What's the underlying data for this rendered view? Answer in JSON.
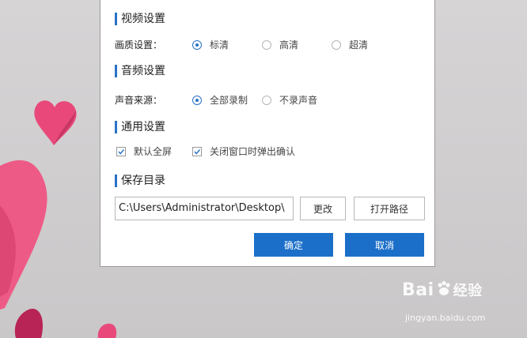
{
  "video": {
    "title": "视频设置",
    "quality_label": "画质设置：",
    "options": [
      {
        "label": "标清",
        "selected": true
      },
      {
        "label": "高清",
        "selected": false
      },
      {
        "label": "超清",
        "selected": false
      }
    ]
  },
  "audio": {
    "title": "音频设置",
    "source_label": "声音来源：",
    "options": [
      {
        "label": "全部录制",
        "selected": true
      },
      {
        "label": "不录声音",
        "selected": false
      }
    ]
  },
  "general": {
    "title": "通用设置",
    "options": [
      {
        "label": "默认全屏",
        "checked": true
      },
      {
        "label": "关闭窗口时弹出确认",
        "checked": true
      }
    ]
  },
  "save": {
    "title": "保存目录",
    "path": "C:\\Users\\Administrator\\Desktop\\",
    "change_label": "更改",
    "open_label": "打开路径"
  },
  "buttons": {
    "ok_label": "确定",
    "cancel_label": "取消"
  },
  "watermark": {
    "brand": "Bai",
    "brand_suffix": "经验",
    "url": "jingyan.baidu.com"
  },
  "colors": {
    "accent": "#2872c7",
    "primary_button": "#1c6fc8",
    "heart_pink": "#e84a78"
  }
}
